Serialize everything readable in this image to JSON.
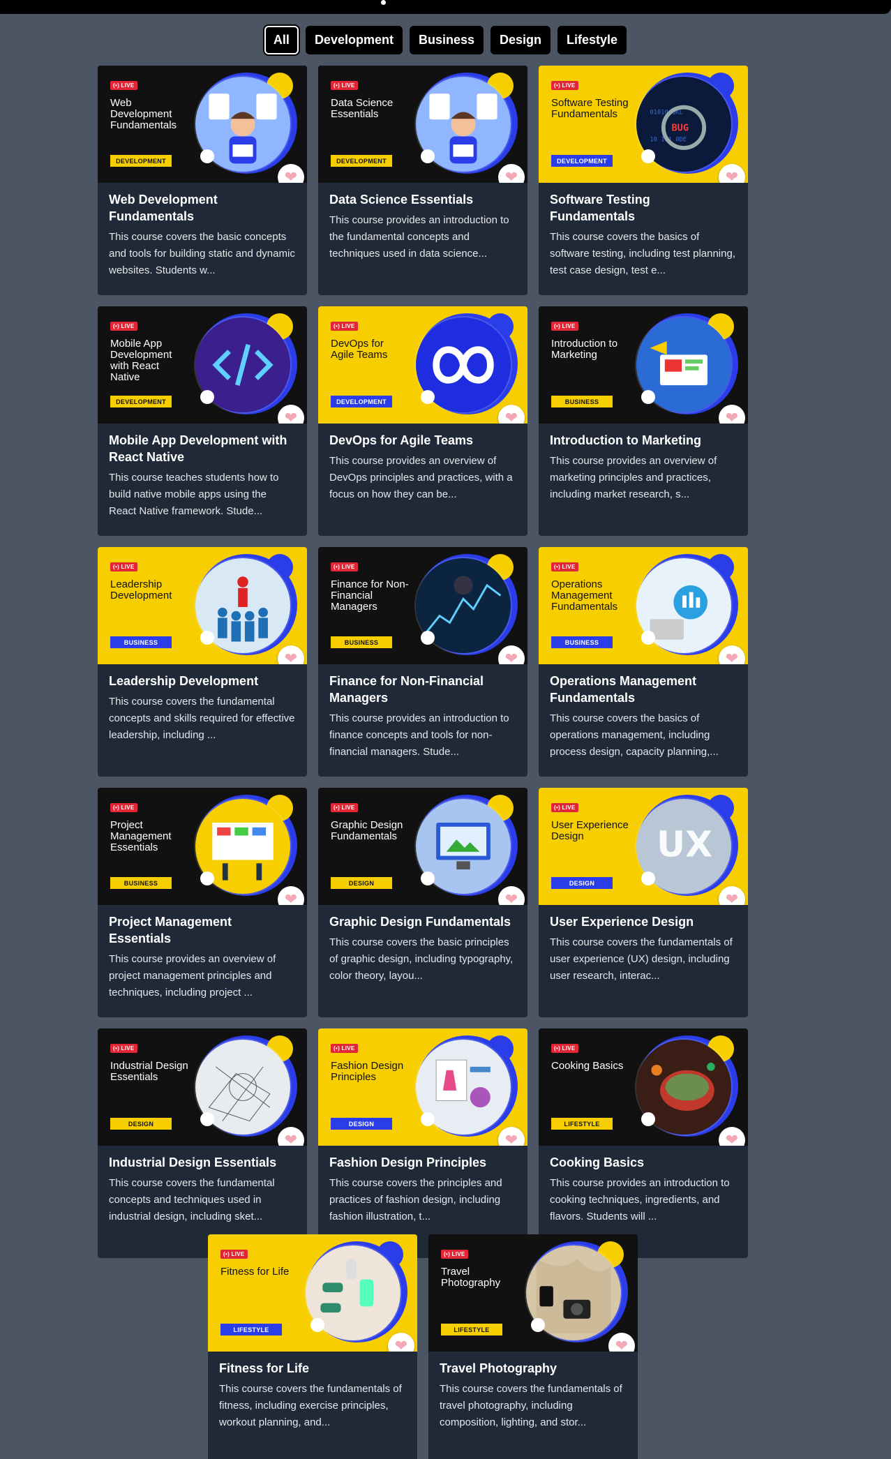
{
  "filters": [
    "All",
    "Development",
    "Business",
    "Design",
    "Lifestyle"
  ],
  "live_badge": "(•) LIVE",
  "courses": [
    {
      "thumb_title": "Web Development Fundamentals",
      "category": "DEVELOPMENT",
      "theme": "dark",
      "title": "Web Development Fundamentals",
      "desc": "This course covers the basic concepts and tools for building static and dynamic websites. Students w...",
      "art": "person-code"
    },
    {
      "thumb_title": "Data Science Essentials",
      "category": "DEVELOPMENT",
      "theme": "dark",
      "title": "Data Science Essentials",
      "desc": "This course provides an introduction to the fundamental concepts and techniques used in data science...",
      "art": "person-code"
    },
    {
      "thumb_title": "Software Testing Fundamentals",
      "category": "DEVELOPMENT",
      "theme": "yellow",
      "title": "Software Testing Fundamentals",
      "desc": "This course covers the basics of software testing, including test planning, test case design, test e...",
      "art": "bug"
    },
    {
      "thumb_title": "Mobile App Development with React Native",
      "category": "DEVELOPMENT",
      "theme": "dark",
      "title": "Mobile App Development with React Native",
      "desc": "This course teaches students how to build native mobile apps using the React Native framework. Stude...",
      "art": "code-tag"
    },
    {
      "thumb_title": "DevOps for Agile Teams",
      "category": "DEVELOPMENT",
      "theme": "yellow",
      "title": "DevOps for Agile Teams",
      "desc": "This course provides an overview of DevOps principles and practices, with a focus on how they can be...",
      "art": "infinity"
    },
    {
      "thumb_title": "Introduction to Marketing",
      "category": "BUSINESS",
      "theme": "dark",
      "title": "Introduction to Marketing",
      "desc": "This course provides an overview of marketing principles and practices, including market research, s...",
      "art": "marketing"
    },
    {
      "thumb_title": "Leadership Development",
      "category": "BUSINESS",
      "theme": "yellow",
      "title": "Leadership Development",
      "desc": "This course covers the fundamental concepts and skills required for effective leadership, including ...",
      "art": "crowd"
    },
    {
      "thumb_title": "Finance for Non-Financial Managers",
      "category": "BUSINESS",
      "theme": "dark",
      "title": "Finance for Non-Financial Managers",
      "desc": "This course provides an introduction to finance concepts and tools for non-financial managers. Stude...",
      "art": "finance"
    },
    {
      "thumb_title": "Operations Management Fundamentals",
      "category": "BUSINESS",
      "theme": "yellow",
      "title": "Operations Management Fundamentals",
      "desc": "This course covers the basics of operations management, including process design, capacity planning,...",
      "art": "gears"
    },
    {
      "thumb_title": "Project Management Essentials",
      "category": "BUSINESS",
      "theme": "dark",
      "title": "Project Management Essentials",
      "desc": "This course provides an overview of project management principles and techniques, including project ...",
      "art": "board"
    },
    {
      "thumb_title": "Graphic Design Fundamentals",
      "category": "DESIGN",
      "theme": "dark",
      "title": "Graphic Design Fundamentals",
      "desc": "This course covers the basic principles of graphic design, including typography, color theory, layou...",
      "art": "monitor"
    },
    {
      "thumb_title": "User Experience Design",
      "category": "DESIGN",
      "theme": "yellow",
      "title": "User Experience Design",
      "desc": "This course covers the fundamentals of user experience (UX) design, including user research, interac...",
      "art": "ux"
    },
    {
      "thumb_title": "Industrial Design Essentials",
      "category": "DESIGN",
      "theme": "dark",
      "title": "Industrial Design Essentials",
      "desc": "This course covers the fundamental concepts and techniques used in industrial design, including sket...",
      "art": "sketch"
    },
    {
      "thumb_title": "Fashion Design Principles",
      "category": "DESIGN",
      "theme": "yellow",
      "title": "Fashion Design Principles",
      "desc": "This course covers the principles and practices of fashion design, including fashion illustration, t...",
      "art": "fashion"
    },
    {
      "thumb_title": "Cooking Basics",
      "category": "LIFESTYLE",
      "theme": "dark",
      "title": "Cooking Basics",
      "desc": "This course provides an introduction to cooking techniques, ingredients, and flavors. Students will ...",
      "art": "cooking"
    },
    {
      "thumb_title": "Fitness for Life",
      "category": "LIFESTYLE",
      "theme": "yellow",
      "title": "Fitness for Life",
      "desc": "This course covers the fundamentals of fitness, including exercise principles, workout planning, and...",
      "art": "fitness"
    },
    {
      "thumb_title": "Travel Photography",
      "category": "LIFESTYLE",
      "theme": "dark",
      "title": "Travel Photography",
      "desc": "This course covers the fundamentals of travel photography, including composition, lighting, and stor...",
      "art": "travel"
    }
  ],
  "colors": {
    "background": "#4b5563",
    "card": "#1f2937",
    "accent_yellow": "#f7cf00",
    "accent_blue": "#2a3de8",
    "live_red": "#e32636",
    "heart_pink": "#f4a7b5"
  },
  "icons": {
    "heart": "heart-icon",
    "live": "live-broadcast-icon"
  }
}
